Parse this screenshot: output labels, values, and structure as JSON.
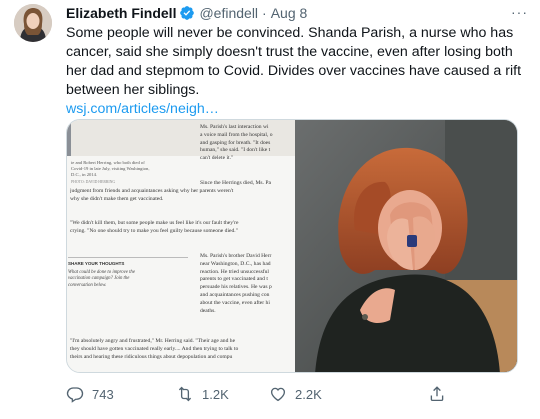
{
  "tweet": {
    "author_name": "Elizabeth Findell",
    "handle": "@efindell",
    "separator": "·",
    "date": "Aug 8",
    "more_label": "···",
    "text_lines": [
      "Some people will never be convinced. Shanda Parish, a nurse who has",
      "cancer, said she simply doesn't trust the vaccine, even after losing both",
      "her dad and stepmom to Covid. Divides over vaccines have caused a rift",
      "between her siblings."
    ],
    "link": "wsj.com/articles/neigh…"
  },
  "article": {
    "caption_lines": [
      "ie and Robert Herring, who both died of",
      "Covid-19 in late July, visiting Washington,",
      "D.C., in 2014.",
      "PHOTO: DAVID HERRING"
    ],
    "right_col_top": [
      "Ms. Parish's last interaction wi",
      "a voice mail from the hospital, o",
      "and gasping for breath. \"It does",
      "human,\" she said. \"I don't like t",
      "can't delete it.\""
    ],
    "mid_lines": [
      "Since the Herrings died, Ms. Pa",
      "judgment from friends and acquaintances asking why her parents weren't",
      "why she didn't make them get vaccinated."
    ],
    "lines_block2": [
      "\"We didn't kill them, but some people make us feel like it's our fault they're",
      "crying. \"No one should try to make you feel guilty because someone died.\""
    ],
    "share_heading": "SHARE YOUR THOUGHTS",
    "share_question": [
      "What could be done to improve the",
      "vaccination campaign? Join the",
      "conversation below."
    ],
    "right_col_bottom": [
      "Ms. Parish's brother David Herr",
      "near Washington, D.C., has had",
      "reaction. He tried unsuccessful",
      "parents to get vaccinated and t",
      "persuade his relatives. He was p",
      "and acquaintances pushing con",
      "about the vaccine, even after hi",
      "deaths."
    ],
    "bottom_lines": [
      "\"I'm absolutely angry and frustrated,\" Mr. Herring said. \"Their age and he",
      "they should have gotten vaccinated really early.... And then trying to talk to",
      "theirs and hearing these ridiculous things about depopulation and compu"
    ]
  },
  "actions": {
    "replies": "743",
    "retweets": "1.2K",
    "likes": "2.2K"
  }
}
